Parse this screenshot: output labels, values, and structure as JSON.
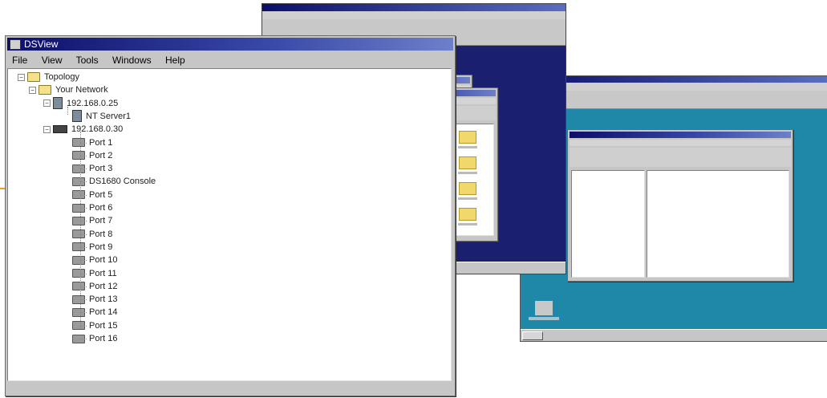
{
  "dsview": {
    "title": "DSView",
    "menu": [
      "File",
      "View",
      "Tools",
      "Windows",
      "Help"
    ],
    "tree": [
      {
        "label": "Topology",
        "type": "folder",
        "level": 0,
        "expander": "−"
      },
      {
        "label": "Your Network",
        "type": "folder",
        "level": 1,
        "expander": "−"
      },
      {
        "label": "192.168.0.25",
        "type": "server",
        "level": 2,
        "expander": "−"
      },
      {
        "label": "NT Server1",
        "type": "server",
        "level": 3,
        "expander": ""
      },
      {
        "label": "192.168.0.30",
        "type": "switch",
        "level": 2,
        "expander": "−"
      },
      {
        "label": "Port 1",
        "type": "port",
        "level": 3,
        "expander": ""
      },
      {
        "label": "Port 2",
        "type": "port",
        "level": 3,
        "expander": ""
      },
      {
        "label": "Port 3",
        "type": "port",
        "level": 3,
        "expander": ""
      },
      {
        "label": "DS1680 Console",
        "type": "port",
        "level": 3,
        "expander": ""
      },
      {
        "label": "Port 5",
        "type": "port",
        "level": 3,
        "expander": ""
      },
      {
        "label": "Port 6",
        "type": "port",
        "level": 3,
        "expander": ""
      },
      {
        "label": "Port 7",
        "type": "port",
        "level": 3,
        "expander": ""
      },
      {
        "label": "Port 8",
        "type": "port",
        "level": 3,
        "expander": ""
      },
      {
        "label": "Port 9",
        "type": "port",
        "level": 3,
        "expander": ""
      },
      {
        "label": "Port 10",
        "type": "port",
        "level": 3,
        "expander": ""
      },
      {
        "label": "Port 11",
        "type": "port",
        "level": 3,
        "expander": ""
      },
      {
        "label": "Port 12",
        "type": "port",
        "level": 3,
        "expander": ""
      },
      {
        "label": "Port 13",
        "type": "port",
        "level": 3,
        "expander": ""
      },
      {
        "label": "Port 14",
        "type": "port",
        "level": 3,
        "expander": ""
      },
      {
        "label": "Port 15",
        "type": "port",
        "level": 3,
        "expander": ""
      },
      {
        "label": "Port 16",
        "type": "port",
        "level": 3,
        "expander": ""
      }
    ]
  },
  "colors": {
    "desktop_blue": "#1a1f6e",
    "desktop_teal": "#1f87a8",
    "titlebar": "#0c0e6a",
    "window_face": "#c6c6c6",
    "accent_arrow": "#f0a020"
  }
}
